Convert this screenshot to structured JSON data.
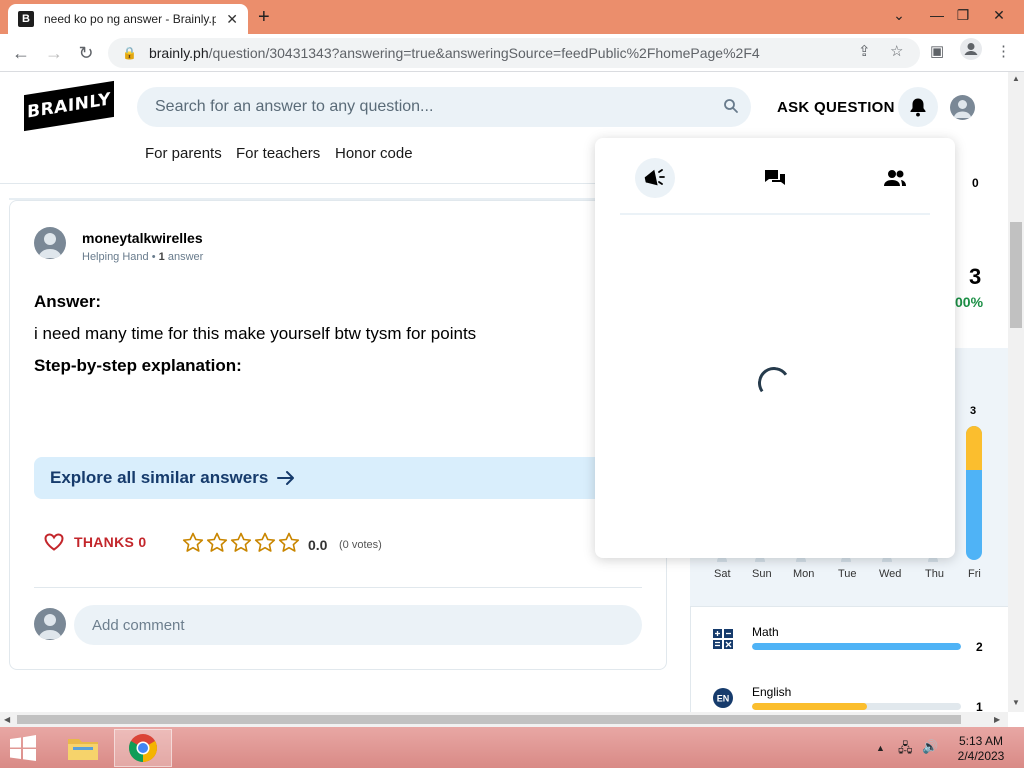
{
  "browser": {
    "tab_title": "need ko po ng answer - Brainly.ph",
    "tab_favicon": "B",
    "new_tab_label": "+",
    "url_host": "brainly.ph",
    "url_path": "/question/30431343?answering=true&answeringSource=feedPublic%2FhomePage%2F4"
  },
  "header": {
    "logo_text": "BRAINLY",
    "search_placeholder": "Search for an answer to any question...",
    "ask_question_label": "ASK QUESTION",
    "nav": {
      "parents": "For parents",
      "teachers": "For teachers",
      "honor": "Honor code"
    }
  },
  "answer": {
    "username": "moneytalkwirelles",
    "rank": "Helping Hand",
    "answer_count": "1",
    "answer_suffix": "answer",
    "answer_label": "Answer:",
    "answer_text": "i need many time for this make yourself btw tysm for points",
    "step_label": "Step-by-step explanation:",
    "explore_label": "Explore all similar answers",
    "thanks_label": "THANKS 0",
    "rating_value": "0.0",
    "votes_label": "(0 votes)",
    "comment_placeholder": "Add comment"
  },
  "sidebar": {
    "top_small": "0",
    "big_number": "3",
    "percent": "00%",
    "bar_value": "3",
    "bar_yellow_fraction": 0.33,
    "days": [
      "Sat",
      "Sun",
      "Mon",
      "Tue",
      "Wed",
      "Thu",
      "Fri"
    ],
    "subjects": [
      {
        "name": "Math",
        "count": "2",
        "fill": 1.0,
        "color": "#4fb3f6",
        "icon": "math-icon"
      },
      {
        "name": "English",
        "count": "1",
        "fill": 0.55,
        "color": "#fbbe2e",
        "icon": "english-icon"
      }
    ]
  },
  "popup": {
    "tabs": [
      "megaphone-icon",
      "messages-icon",
      "friends-icon"
    ],
    "state": "loading"
  },
  "taskbar": {
    "time": "5:13 AM",
    "date": "2/4/2023"
  },
  "colors": {
    "tab_bar": "#eb8e6c",
    "accent_blue": "#163b6c",
    "thanks_red": "#c3262b",
    "star_gold": "#c98600",
    "success_green": "#1b8f45"
  }
}
